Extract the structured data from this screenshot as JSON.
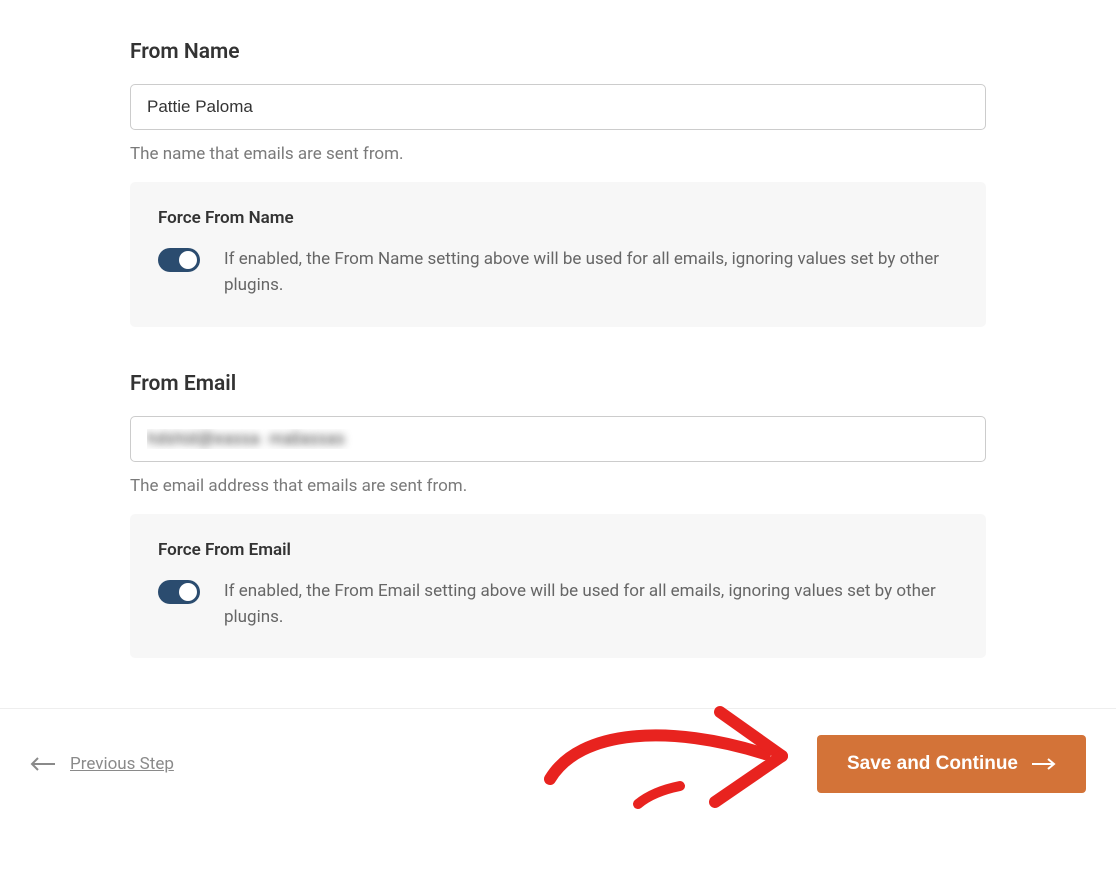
{
  "fromName": {
    "label": "From Name",
    "value": "Pattie Paloma",
    "help": "The name that emails are sent from.",
    "force": {
      "title": "Force From Name",
      "description": "If enabled, the From Name setting above will be used for all emails, ignoring values set by other plugins.",
      "enabled": true
    }
  },
  "fromEmail": {
    "label": "From Email",
    "value": "hdshid@eassa  maliassas",
    "help": "The email address that emails are sent from.",
    "force": {
      "title": "Force From Email",
      "description": "If enabled, the From Email setting above will be used for all emails, ignoring values set by other plugins.",
      "enabled": true
    }
  },
  "footer": {
    "previous": "Previous Step",
    "save": "Save and Continue"
  },
  "colors": {
    "accent": "#d37338",
    "toggle": "#2b4c6f",
    "annotation": "#e8231f"
  }
}
